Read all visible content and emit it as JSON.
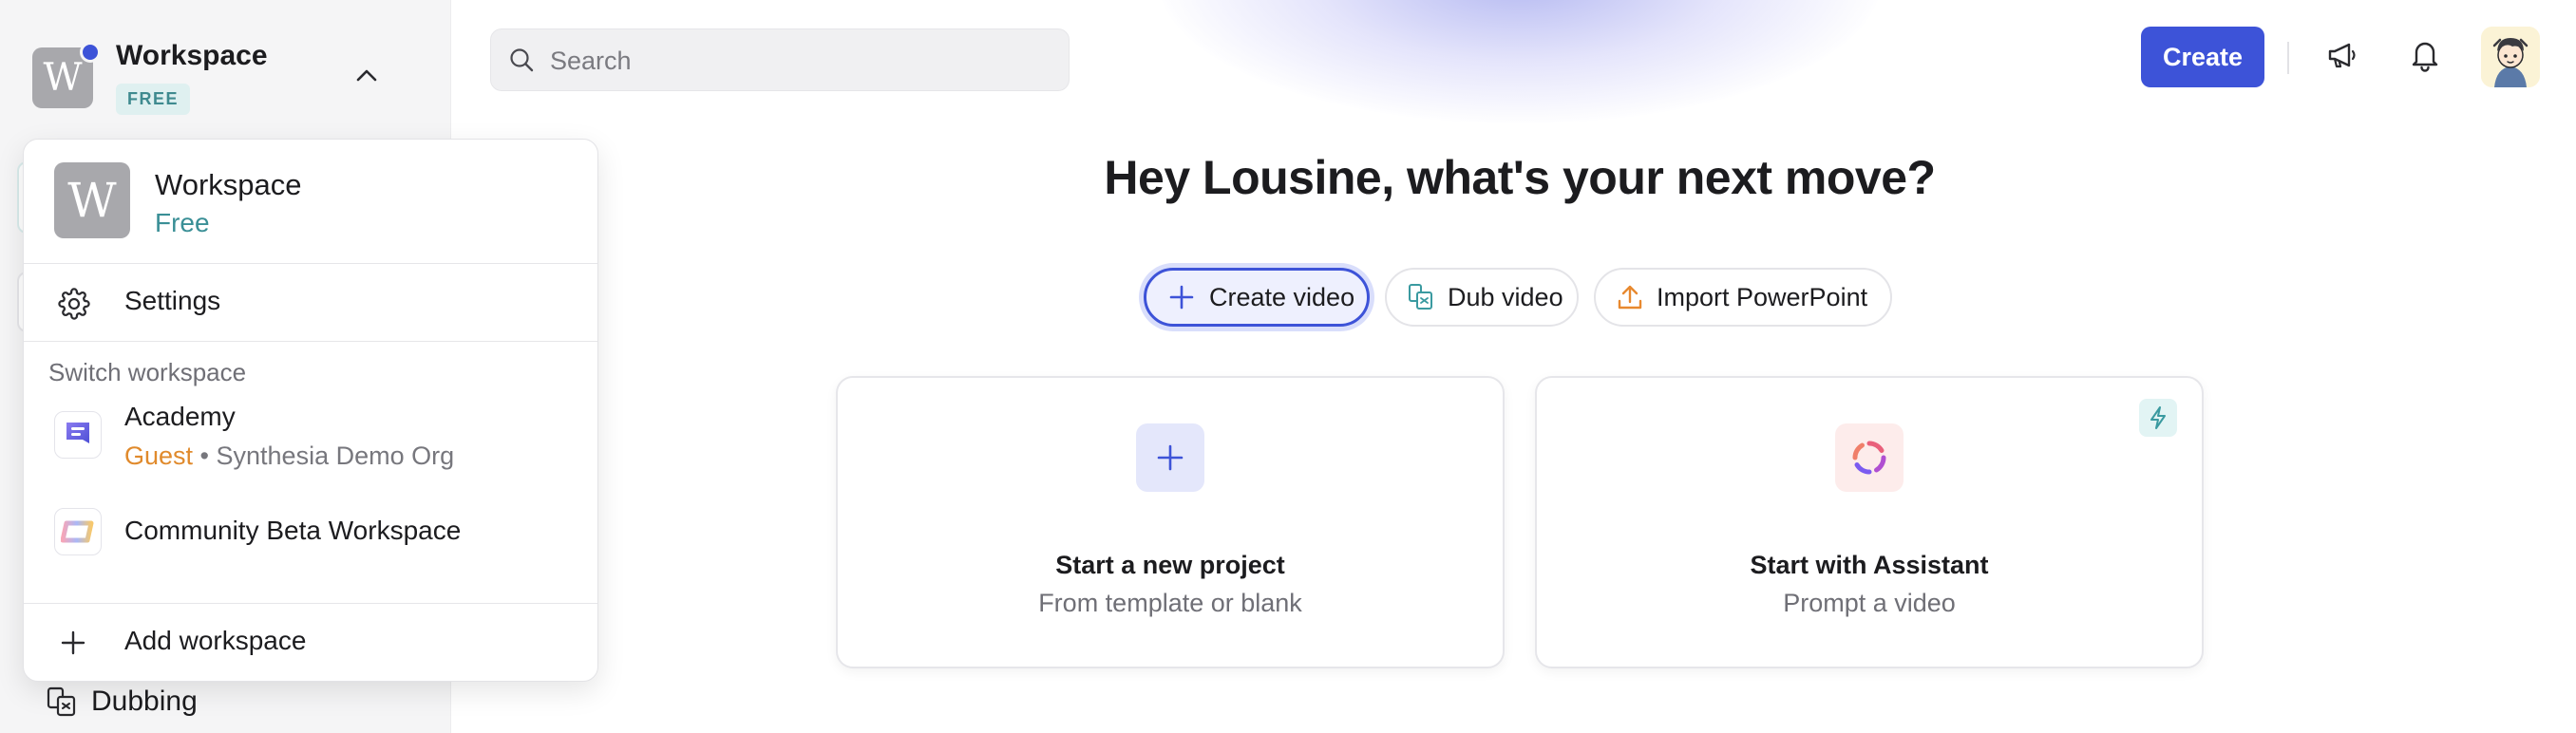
{
  "sidebar": {
    "workspace": {
      "initial": "W",
      "name": "Workspace",
      "plan_badge": "FREE"
    },
    "items": {
      "dubbing": "Dubbing"
    }
  },
  "workspace_menu": {
    "current": {
      "initial": "W",
      "name": "Workspace",
      "plan": "Free"
    },
    "settings_label": "Settings",
    "switch_heading": "Switch workspace",
    "workspaces": [
      {
        "name": "Academy",
        "role": "Guest",
        "separator": " • ",
        "org": "Synthesia Demo Org"
      },
      {
        "name": "Community Beta Workspace"
      }
    ],
    "add_label": "Add workspace"
  },
  "topbar": {
    "search_placeholder": "Search",
    "search_value": "",
    "create_label": "Create"
  },
  "main": {
    "greeting": "Hey Lousine, what's your next move?",
    "actions": [
      {
        "label": "Create video",
        "selected": true,
        "icon": "plus-icon"
      },
      {
        "label": "Dub video",
        "icon": "dub-icon"
      },
      {
        "label": "Import PowerPoint",
        "icon": "upload-icon"
      }
    ],
    "cards": [
      {
        "title": "Start a new project",
        "subtitle": "From template or blank",
        "icon": "plus-icon"
      },
      {
        "title": "Start with Assistant",
        "subtitle": "Prompt a video",
        "icon": "assistant-ring-icon",
        "badge_icon": "lightning-icon"
      }
    ]
  },
  "colors": {
    "accent": "#3d53d8",
    "plan_teal": "#3a8f96",
    "guest_orange": "#e08a2c",
    "sidebar_bg": "#f5f5f6"
  }
}
